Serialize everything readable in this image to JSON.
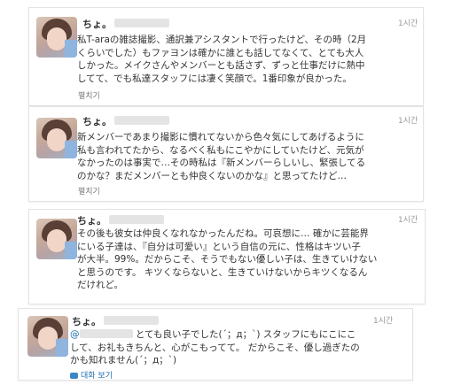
{
  "tweets": [
    {
      "name": "ちょ。",
      "time": "1시간",
      "lines": [
        "私T-araの雑誌撮影、通訳兼アシスタントで行ったけど、その時（2月",
        "くらいでした）もファヨンは確かに誰とも話してなくて、とても大人",
        "しかった。メイクさんやメンバーとも話さず、ずっと仕事だけに熱中",
        "してて、でも私達スタッフには凄く笑顔で。1番印象が良かった。"
      ],
      "action": "펼치기"
    },
    {
      "name": "ちょ。",
      "time": "1시간",
      "lines": [
        "新メンバーであまり撮影に慣れてないから色々気にしてあげるように",
        "私も言われてたから、なるべく私もにこやかにしていたけど、元気が",
        "なかったのは事実で…その時私は『新メンバーらしいし、緊張してる",
        "のかな？まだメンバーとも仲良くないのかな』と思ってたけど…"
      ],
      "action": "펼치기"
    },
    {
      "name": "ちょ。",
      "time": "1시간",
      "lines": [
        "その後も彼女は仲良くなれなかったんだね。可哀想に… 確かに芸能界",
        "にいる子達は、『自分は可愛い』という自信の元に、性格はキツい子",
        "が大半。99%。だからこそ、そうでもない優しい子は、生きていけない",
        "と思うのです。 キツくならないと、生きていけないからキツくなるん",
        "だけれど。"
      ],
      "action": "펼치기"
    },
    {
      "name": "ちょ。",
      "time": "1시간",
      "mention": "@",
      "lines": [
        "とても良い子でした(´；д；`) スタッフにもにこにこ",
        "して、お礼もきちんと、心がこもってて。 だからこそ、優し過ぎたの",
        "かも知れません(´；д；`)"
      ],
      "action": "대화 보기"
    }
  ]
}
